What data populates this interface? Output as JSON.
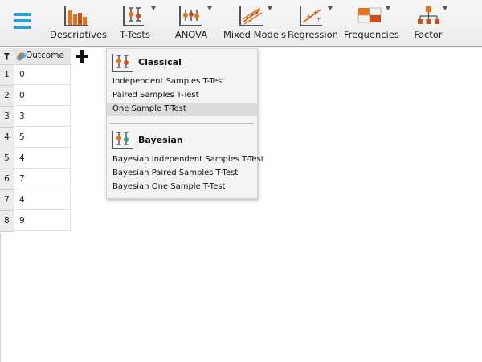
{
  "toolbar": {
    "tools": [
      {
        "label": "Descriptives",
        "icon": "descriptives-bar-chart-icon"
      },
      {
        "label": "T-Tests",
        "icon": "t-tests-icon"
      },
      {
        "label": "ANOVA",
        "icon": "anova-icon"
      },
      {
        "label": "Mixed Models",
        "icon": "mixed-models-icon"
      },
      {
        "label": "Regression",
        "icon": "regression-icon"
      },
      {
        "label": "Frequencies",
        "icon": "frequencies-icon"
      },
      {
        "label": "Factor",
        "icon": "factor-icon"
      }
    ]
  },
  "grid": {
    "column_header": "Outcome",
    "rows": [
      {
        "n": "1",
        "value": "0"
      },
      {
        "n": "2",
        "value": "0"
      },
      {
        "n": "3",
        "value": "3"
      },
      {
        "n": "4",
        "value": "5"
      },
      {
        "n": "5",
        "value": "4"
      },
      {
        "n": "6",
        "value": "7"
      },
      {
        "n": "7",
        "value": "4"
      },
      {
        "n": "8",
        "value": "9"
      }
    ]
  },
  "menu": {
    "classical": {
      "title": "Classical",
      "items": [
        "Independent Samples T-Test",
        "Paired Samples T-Test",
        "One Sample T-Test"
      ],
      "highlighted_index": 2
    },
    "bayesian": {
      "title": "Bayesian",
      "items": [
        "Bayesian Independent Samples T-Test",
        "Bayesian Paired Samples T-Test",
        "Bayesian One Sample T-Test"
      ]
    }
  },
  "colors": {
    "accent_blue": "#2e9fd6",
    "orange": "#e8731a",
    "dark_orange": "#c8521a",
    "green": "#26a66a",
    "highlight": "#dcdcdc"
  }
}
